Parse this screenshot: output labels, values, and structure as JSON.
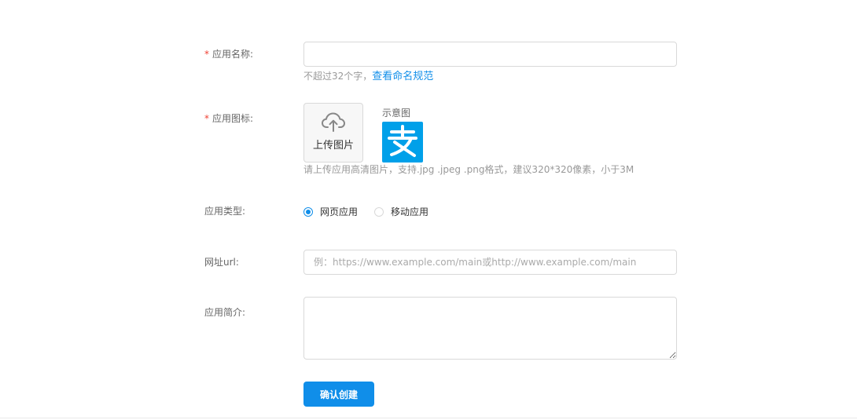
{
  "form": {
    "app_name": {
      "required_mark": "*",
      "label": "应用名称:",
      "value": "",
      "hint_text": "不超过32个字，",
      "hint_link": "查看命名规范"
    },
    "app_icon": {
      "required_mark": "*",
      "label": "应用图标:",
      "upload_label": "上传图片",
      "upload_icon": "cloud-upload-icon",
      "sample_label": "示意图",
      "sample_logo": "alipay-logo",
      "hint_text": "请上传应用高清图片，支持.jpg .jpeg .png格式，建议320*320像素，小于3M"
    },
    "app_type": {
      "label": "应用类型:",
      "options": [
        {
          "label": "网页应用",
          "checked": true
        },
        {
          "label": "移动应用",
          "checked": false
        }
      ]
    },
    "url": {
      "label": "网址url:",
      "value": "",
      "placeholder": "例：https://www.example.com/main或http://www.example.com/main"
    },
    "description": {
      "label": "应用简介:",
      "value": ""
    },
    "submit_label": "确认创建"
  },
  "colors": {
    "primary": "#108ee9",
    "required": "#f04134",
    "alipay_blue": "#00a0e9"
  }
}
